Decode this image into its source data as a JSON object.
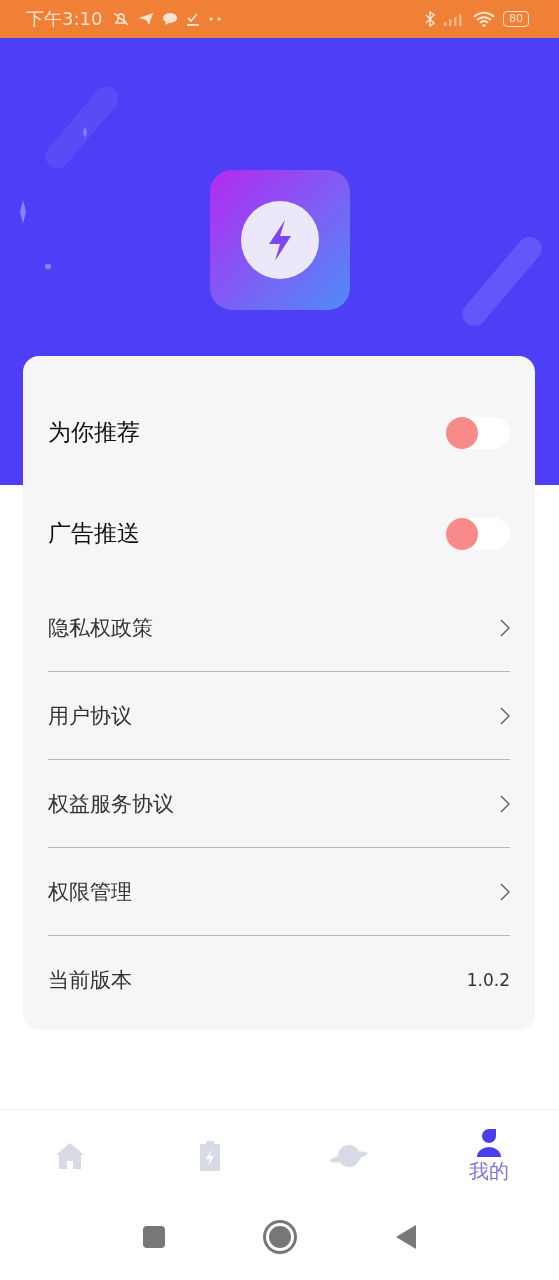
{
  "status_bar": {
    "time": "下午3:10",
    "battery": "80"
  },
  "toggles": [
    {
      "label": "为你推荐",
      "on": false
    },
    {
      "label": "广告推送",
      "on": false
    }
  ],
  "links": [
    {
      "kind": "link",
      "label": "隐私权政策"
    },
    {
      "kind": "link",
      "label": "用户协议"
    },
    {
      "kind": "link",
      "label": "权益服务协议"
    },
    {
      "kind": "link",
      "label": "权限管理"
    },
    {
      "kind": "info",
      "label": "当前版本",
      "value": "1.0.2"
    }
  ],
  "tabs": [
    {
      "kind": "home",
      "selected": false
    },
    {
      "kind": "battery",
      "selected": false
    },
    {
      "kind": "planet",
      "selected": false
    },
    {
      "kind": "person",
      "label": "我的",
      "selected": true
    }
  ]
}
